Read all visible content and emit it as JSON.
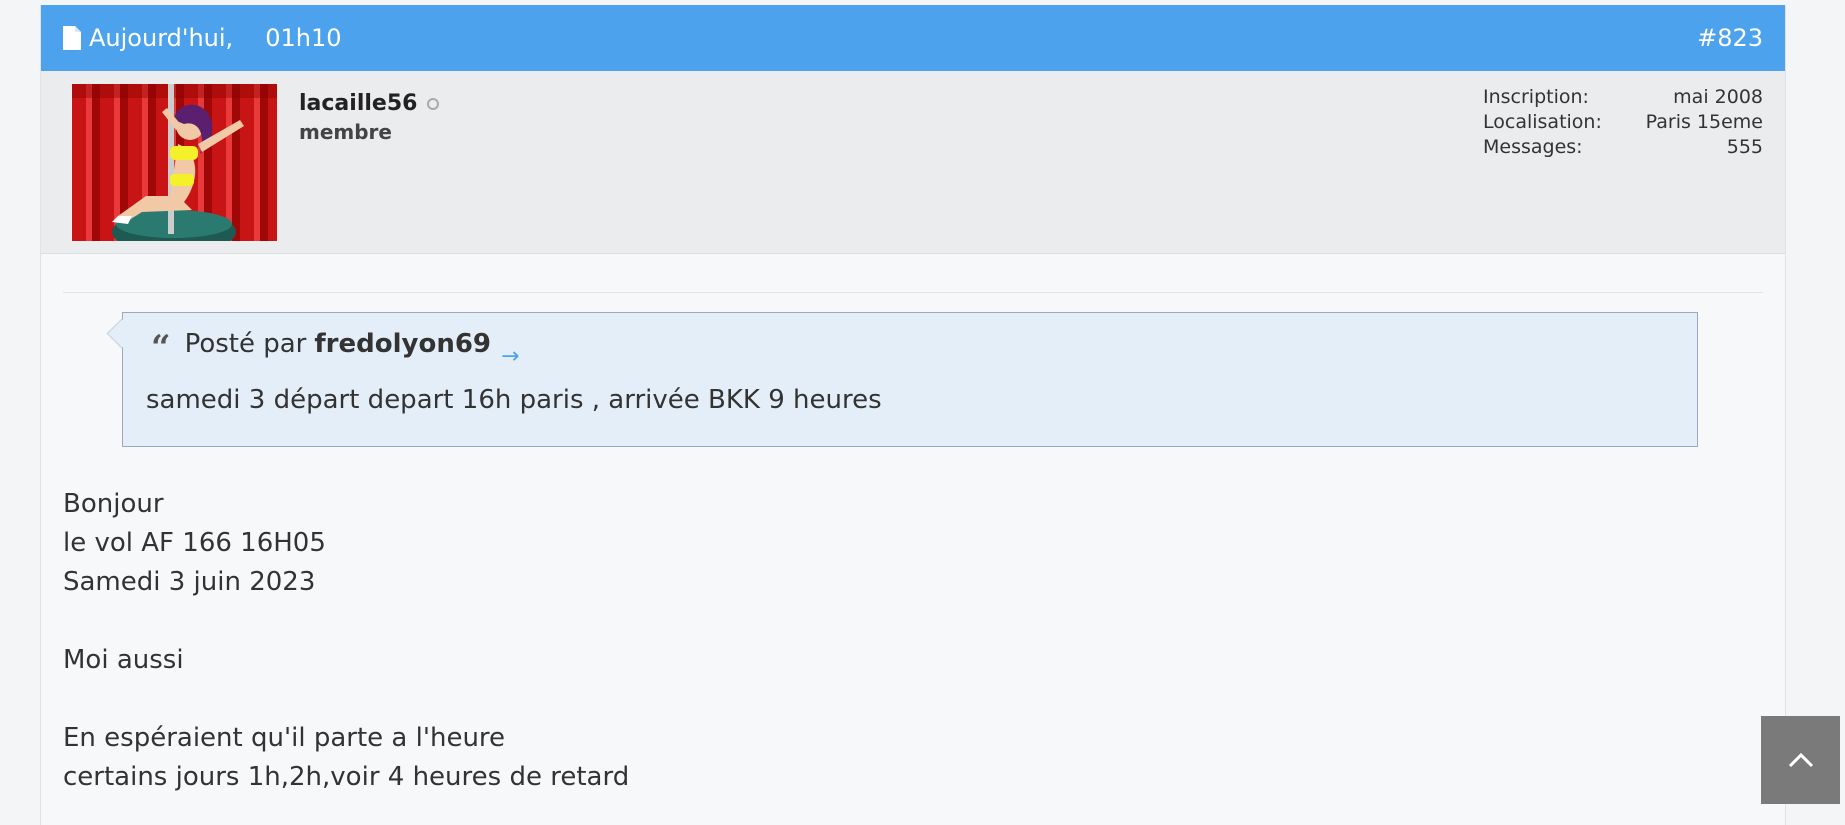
{
  "post": {
    "header": {
      "date": "Aujourd'hui,",
      "time": "01h10",
      "number": "#823"
    },
    "user": {
      "name": "lacaille56",
      "rank": "membre",
      "stats": [
        {
          "label": "Inscription:",
          "value": "mai 2008"
        },
        {
          "label": "Localisation:",
          "value": "Paris 15eme"
        },
        {
          "label": "Messages:",
          "value": "555"
        }
      ]
    },
    "quote": {
      "prefix": "Posté par",
      "author": "fredolyon69",
      "link_icon": "→",
      "text": "samedi 3 départ depart 16h paris , arrivée BKK 9 heures"
    },
    "message": {
      "lines": [
        "Bonjour",
        "le vol AF 166 16H05",
        "Samedi 3 juin 2023",
        "",
        "Moi aussi",
        "",
        "En espéraient qu'il parte a l'heure",
        "certains jours 1h,2h,voir 4 heures de retard"
      ]
    }
  },
  "colors": {
    "header_bg": "#4da2ee",
    "userbar_bg": "#ebecee",
    "quote_bg": "#e4eef8",
    "scroll_button_bg": "#7a7a7a"
  },
  "icons": {
    "header": "document-icon",
    "status": "offline-dot-icon",
    "quote": "quote-icon",
    "scroll": "chevron-up-icon"
  }
}
